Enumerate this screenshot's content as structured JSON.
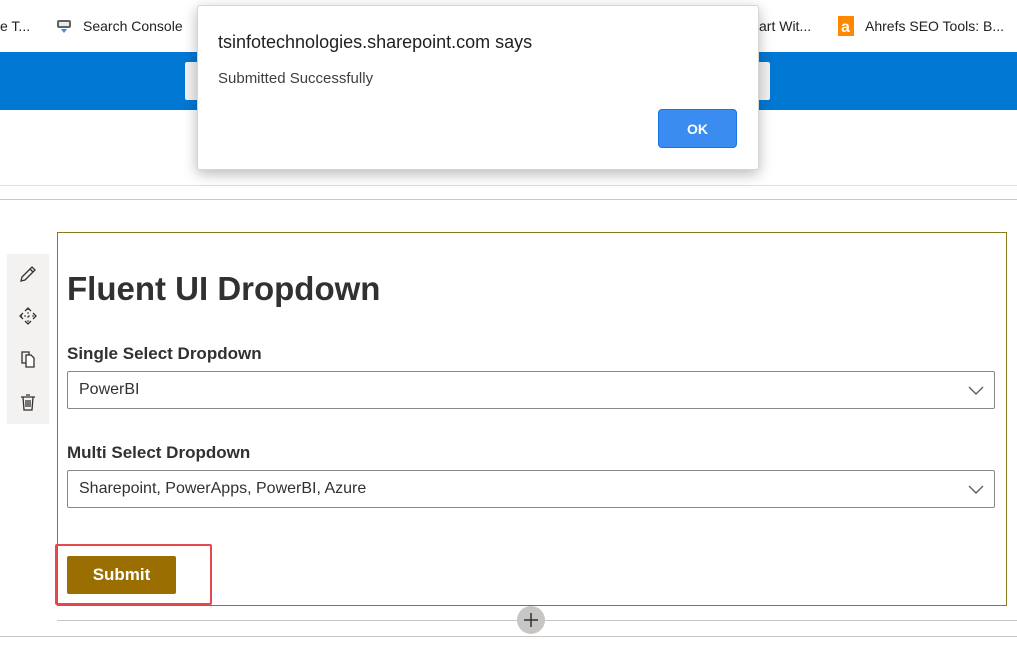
{
  "bookmarks": [
    {
      "label": "e T...",
      "icon": "none"
    },
    {
      "label": "Search Console",
      "icon": "search-console-icon"
    },
    {
      "label": "art Wit...",
      "icon": "none"
    },
    {
      "label": "Ahrefs SEO Tools: B...",
      "icon": "ahrefs-icon"
    }
  ],
  "dialog": {
    "title": "tsinfotechnologies.sharepoint.com says",
    "message": "Submitted Successfully",
    "ok_label": "OK"
  },
  "toolbar": {
    "icons": [
      "edit-pencil-icon",
      "move-icon",
      "duplicate-icon",
      "delete-icon"
    ]
  },
  "webpart": {
    "title": "Fluent UI Dropdown",
    "single": {
      "label": "Single Select Dropdown",
      "value": "PowerBI"
    },
    "multi": {
      "label": "Multi Select Dropdown",
      "value": "Sharepoint, PowerApps, PowerBI, Azure"
    },
    "submit_label": "Submit"
  },
  "colors": {
    "suite_bar": "#0078d4",
    "submit": "#9a6e00",
    "highlight": "#e5494b",
    "ok_button": "#3b8cf0",
    "webpart_border": "#8a7a1e"
  }
}
